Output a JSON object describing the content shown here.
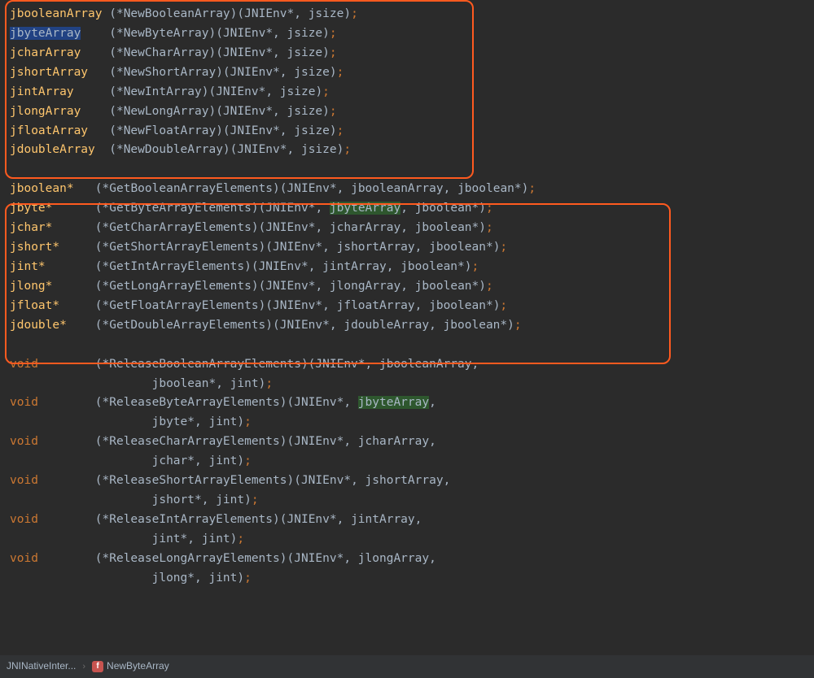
{
  "code": {
    "new_array": [
      {
        "ret": "jbooleanArray",
        "pad": " ",
        "func": "NewBooleanArray",
        "args": [
          "JNIEnv*",
          "jsize"
        ]
      },
      {
        "ret": "jbyteArray",
        "pad": "    ",
        "sel": true,
        "func": "NewByteArray",
        "args": [
          "JNIEnv*",
          "jsize"
        ]
      },
      {
        "ret": "jcharArray",
        "pad": "    ",
        "func": "NewCharArray",
        "args": [
          "JNIEnv*",
          "jsize"
        ]
      },
      {
        "ret": "jshortArray",
        "pad": "   ",
        "func": "NewShortArray",
        "args": [
          "JNIEnv*",
          "jsize"
        ]
      },
      {
        "ret": "jintArray",
        "pad": "     ",
        "func": "NewIntArray",
        "args": [
          "JNIEnv*",
          "jsize"
        ]
      },
      {
        "ret": "jlongArray",
        "pad": "    ",
        "func": "NewLongArray",
        "args": [
          "JNIEnv*",
          "jsize"
        ]
      },
      {
        "ret": "jfloatArray",
        "pad": "   ",
        "func": "NewFloatArray",
        "args": [
          "JNIEnv*",
          "jsize"
        ]
      },
      {
        "ret": "jdoubleArray",
        "pad": "  ",
        "func": "NewDoubleArray",
        "args": [
          "JNIEnv*",
          "jsize"
        ]
      }
    ],
    "get_elements": [
      {
        "ret": "jboolean*",
        "pad": "   ",
        "func": "GetBooleanArrayElements",
        "args": [
          "JNIEnv*",
          "jbooleanArray",
          "jboolean*"
        ]
      },
      {
        "ret": "jbyte*",
        "pad": "      ",
        "func": "GetByteArrayElements",
        "args": [
          "JNIEnv*",
          {
            "text": "jbyteArray",
            "hit": true
          },
          "jboolean*"
        ]
      },
      {
        "ret": "jchar*",
        "pad": "      ",
        "func": "GetCharArrayElements",
        "args": [
          "JNIEnv*",
          "jcharArray",
          "jboolean*"
        ]
      },
      {
        "ret": "jshort*",
        "pad": "     ",
        "func": "GetShortArrayElements",
        "args": [
          "JNIEnv*",
          "jshortArray",
          "jboolean*"
        ]
      },
      {
        "ret": "jint*",
        "pad": "       ",
        "func": "GetIntArrayElements",
        "args": [
          "JNIEnv*",
          "jintArray",
          "jboolean*"
        ]
      },
      {
        "ret": "jlong*",
        "pad": "      ",
        "func": "GetLongArrayElements",
        "args": [
          "JNIEnv*",
          "jlongArray",
          "jboolean*"
        ]
      },
      {
        "ret": "jfloat*",
        "pad": "     ",
        "func": "GetFloatArrayElements",
        "args": [
          "JNIEnv*",
          "jfloatArray",
          "jboolean*"
        ]
      },
      {
        "ret": "jdouble*",
        "pad": "    ",
        "func": "GetDoubleArrayElements",
        "args": [
          "JNIEnv*",
          "jdoubleArray",
          "jboolean*"
        ]
      }
    ],
    "release_elements": [
      {
        "func": "ReleaseBooleanArrayElements",
        "args1": [
          "JNIEnv*",
          "jbooleanArray"
        ],
        "args2": [
          "jboolean*",
          "jint"
        ]
      },
      {
        "func": "ReleaseByteArrayElements",
        "args1": [
          "JNIEnv*",
          {
            "text": "jbyteArray",
            "hit": true
          }
        ],
        "args2": [
          "jbyte*",
          "jint"
        ]
      },
      {
        "func": "ReleaseCharArrayElements",
        "args1": [
          "JNIEnv*",
          "jcharArray"
        ],
        "args2": [
          "jchar*",
          "jint"
        ]
      },
      {
        "func": "ReleaseShortArrayElements",
        "args1": [
          "JNIEnv*",
          "jshortArray"
        ],
        "args2": [
          "jshort*",
          "jint"
        ]
      },
      {
        "func": "ReleaseIntArrayElements",
        "args1": [
          "JNIEnv*",
          "jintArray"
        ],
        "args2": [
          "jint*",
          "jint"
        ]
      },
      {
        "func": "ReleaseLongArrayElements",
        "args1": [
          "JNIEnv*",
          "jlongArray"
        ],
        "args2": [
          "jlong*",
          "jint"
        ]
      }
    ],
    "void_label": "void",
    "indent2": "                    "
  },
  "breadcrumb": {
    "class_name": "JNINativeInter...",
    "badge_letter": "f",
    "member": "NewByteArray"
  }
}
